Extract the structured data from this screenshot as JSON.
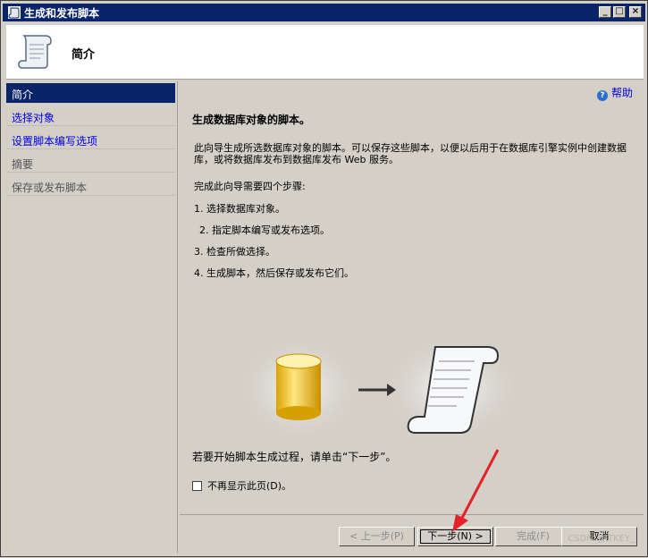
{
  "window": {
    "title": "生成和发布脚本",
    "controls": [
      "_",
      "□",
      "×"
    ]
  },
  "header": {
    "title": "简介",
    "icon": "scroll-icon"
  },
  "sidebar": {
    "items": [
      {
        "label": "简介",
        "state": "selected"
      },
      {
        "label": "选择对象",
        "state": "link"
      },
      {
        "label": "设置脚本编写选项",
        "state": "link"
      },
      {
        "label": "摘要",
        "state": "disabled"
      },
      {
        "label": "保存或发布脚本",
        "state": "disabled"
      }
    ]
  },
  "content": {
    "help_label": "帮助",
    "heading": "生成数据库对象的脚本。",
    "description": "此向导生成所选数据库对象的脚本。可以保存这些脚本，以便以后用于在数据库引擎实例中创建数据库，或将数据库发布到数据库发布 Web 服务。",
    "steps_intro": "完成此向导需要四个步骤:",
    "steps": [
      "1. 选择数据库对象。",
      "2. 指定脚本编写或发布选项。",
      "3. 检查所做选择。",
      "4. 生成脚本，然后保存或发布它们。"
    ],
    "start_hint": "若要开始脚本生成过程，请单击“下一步”。",
    "checkbox_label": "不再显示此页(D)。",
    "checkbox_checked": false
  },
  "footer": {
    "back": "< 上一步(P)",
    "next": "下一步(N) >",
    "finish": "完成(F)",
    "cancel": "取消"
  },
  "watermark": "CSDN @ITKEY_"
}
